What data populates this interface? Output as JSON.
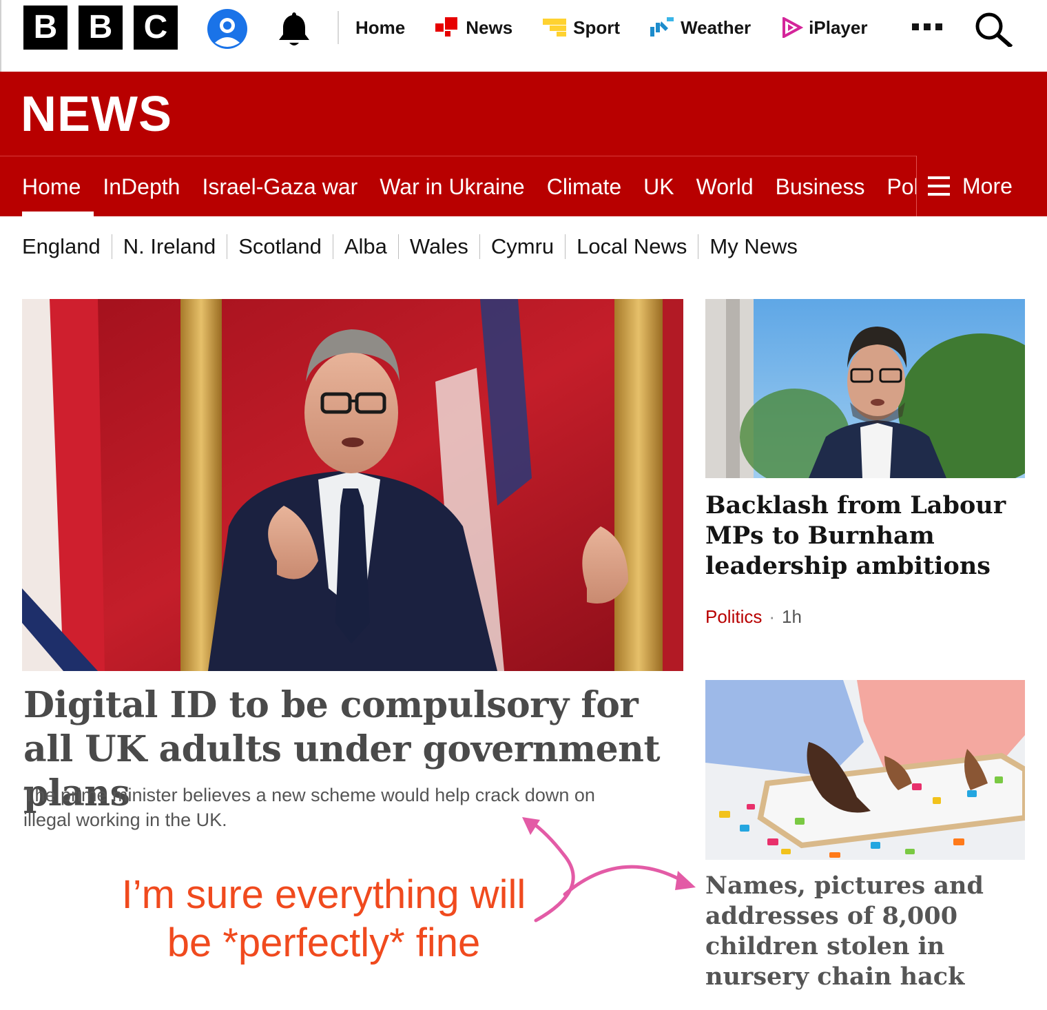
{
  "masthead": {
    "logo_letters": [
      "B",
      "B",
      "C"
    ],
    "nav": [
      {
        "label": "Home",
        "icon": "none"
      },
      {
        "label": "News",
        "icon": "news-icon"
      },
      {
        "label": "Sport",
        "icon": "sport-icon"
      },
      {
        "label": "Weather",
        "icon": "weather-icon"
      },
      {
        "label": "iPlayer",
        "icon": "iplayer-icon"
      }
    ],
    "colors": {
      "account": "#1a73e8",
      "news": "#e60000",
      "sport": "#ffd230",
      "weather": "#1d8ccc",
      "iplayer": "#d4259a"
    }
  },
  "section_title": "NEWS",
  "primary_nav": {
    "items": [
      "Home",
      "InDepth",
      "Israel-Gaza war",
      "War in Ukraine",
      "Climate",
      "UK",
      "World",
      "Business",
      "Politics"
    ],
    "more_label": "More",
    "active": "Home"
  },
  "secondary_nav": {
    "items": [
      "England",
      "N. Ireland",
      "Scotland",
      "Alba",
      "Wales",
      "Cymru",
      "Local News",
      "My News"
    ]
  },
  "main_story": {
    "headline": "Digital ID to be compulsory for all UK adults under government plans",
    "summary": "The prime minister believes a new scheme would help crack down on illegal working in the UK."
  },
  "side_stories": [
    {
      "headline": "Backlash from Labour MPs to Burnham leadership ambitions",
      "category": "Politics",
      "time": "1h"
    },
    {
      "headline": "Names, pictures and addresses of 8,000 children stolen in nursery chain hack"
    }
  ],
  "annotation": {
    "line1": "I’m sure everything will",
    "line2": "be *perfectly* fine",
    "color": "#f04a1e",
    "arrow_color": "#e35ba6"
  },
  "theme": {
    "brand_red": "#b80000"
  }
}
